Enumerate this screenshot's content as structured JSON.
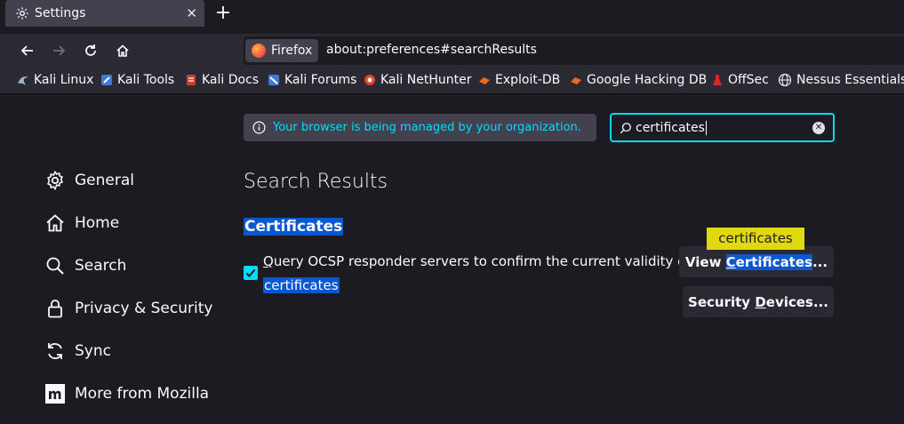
{
  "tab": {
    "title": "Settings",
    "close_glyph": "✕"
  },
  "newtab_glyph": "+",
  "nav": {
    "identity_label": "Firefox",
    "url": "about:preferences#searchResults"
  },
  "bookmarks": [
    {
      "label": "Kali Linux",
      "icon": "kali-dragon-icon",
      "color": "#9fb3c8"
    },
    {
      "label": "Kali Tools",
      "icon": "kali-tools-icon",
      "color": "#3d7bd6"
    },
    {
      "label": "Kali Docs",
      "icon": "kali-docs-icon",
      "color": "#d33a2c"
    },
    {
      "label": "Kali Forums",
      "icon": "kali-forums-icon",
      "color": "#3d7bd6"
    },
    {
      "label": "Kali NetHunter",
      "icon": "nethunter-icon",
      "color": "#e0452f"
    },
    {
      "label": "Exploit-DB",
      "icon": "exploit-db-icon",
      "color": "#e86b1e"
    },
    {
      "label": "Google Hacking DB",
      "icon": "ghdb-icon",
      "color": "#e86b1e"
    },
    {
      "label": "OffSec",
      "icon": "offsec-icon",
      "color": "#d9262c"
    },
    {
      "label": "Nessus Essentials",
      "icon": "globe-icon",
      "color": "#e0e0e6"
    }
  ],
  "sidebar": {
    "items": [
      {
        "label": "General",
        "icon": "gear-icon"
      },
      {
        "label": "Home",
        "icon": "home-icon"
      },
      {
        "label": "Search",
        "icon": "search-icon"
      },
      {
        "label": "Privacy & Security",
        "icon": "lock-icon"
      },
      {
        "label": "Sync",
        "icon": "sync-icon"
      },
      {
        "label": "More from Mozilla",
        "icon": "mozilla-icon"
      }
    ]
  },
  "policy_notice": "Your browser is being managed by your organization.",
  "search": {
    "value": "certificates"
  },
  "main": {
    "heading": "Search Results",
    "section_title": "Certificates",
    "ocsp_checked": true,
    "ocsp_access_key": "Q",
    "ocsp_line1_rest": "uery OCSP responder servers to confirm the current validity of",
    "ocsp_line2": "certificates",
    "tooltip": "certificates",
    "view_btn": {
      "pre": "View ",
      "access_key": "C",
      "hl_rest": "ertificates",
      "post": "..."
    },
    "devices_btn": {
      "pre": "Security ",
      "access_key": "D",
      "post": "evices..."
    }
  },
  "colors": {
    "accent": "#00ddff",
    "highlight": "#0b57d0",
    "tooltip": "#e0d90f",
    "background": "#1c1b22"
  }
}
